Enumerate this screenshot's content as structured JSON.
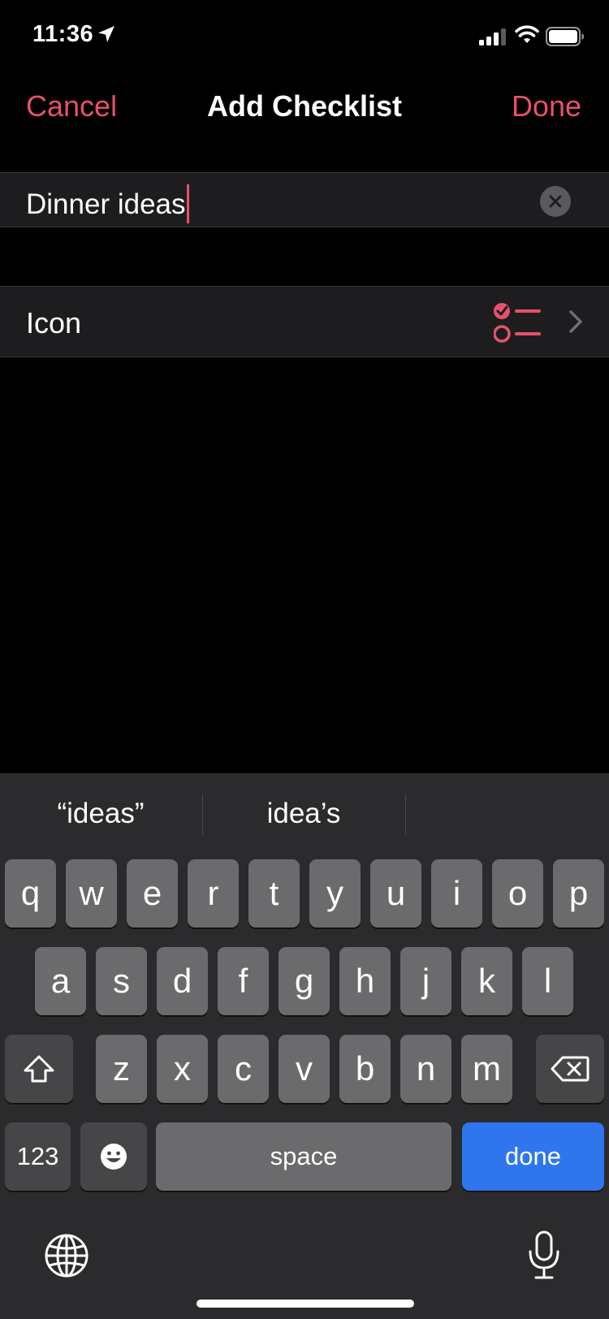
{
  "status_bar": {
    "time": "11:36"
  },
  "nav": {
    "cancel_label": "Cancel",
    "title": "Add Checklist",
    "done_label": "Done"
  },
  "name_field": {
    "value": "Dinner ideas"
  },
  "icon_row": {
    "label": "Icon",
    "icon": "checklist-icon"
  },
  "keyboard": {
    "suggestions": [
      "“ideas”",
      "idea’s",
      ""
    ],
    "row1": [
      "q",
      "w",
      "e",
      "r",
      "t",
      "y",
      "u",
      "i",
      "o",
      "p"
    ],
    "row2": [
      "a",
      "s",
      "d",
      "f",
      "g",
      "h",
      "j",
      "k",
      "l"
    ],
    "row3": [
      "z",
      "x",
      "c",
      "v",
      "b",
      "n",
      "m"
    ],
    "numbers_label": "123",
    "space_label": "space",
    "done_label": "done"
  },
  "colors": {
    "accent": "#e8506a",
    "keyboard_done": "#2f76ee",
    "cell_background": "#1d1d1f"
  }
}
